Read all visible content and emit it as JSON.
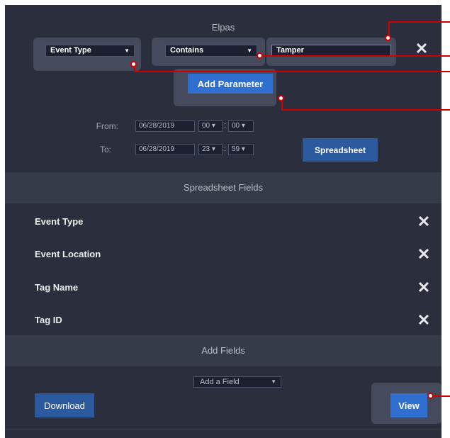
{
  "header": {
    "title": "Elpas"
  },
  "filter": {
    "field_select": "Event Type",
    "operator_select": "Contains",
    "value_input": "Tamper",
    "add_parameter_label": "Add Parameter"
  },
  "range": {
    "from_label": "From:",
    "to_label": "To:",
    "from_date": "06/28/2019",
    "from_hour": "00",
    "from_minute": "00",
    "to_date": "06/28/2019",
    "to_hour": "23",
    "to_minute": "59",
    "spreadsheet_label": "Spreadsheet"
  },
  "spreadsheet_fields": {
    "title": "Spreadsheet Fields",
    "items": [
      {
        "label": "Event Type"
      },
      {
        "label": "Event Location"
      },
      {
        "label": "Tag Name"
      },
      {
        "label": "Tag ID"
      }
    ]
  },
  "add_fields": {
    "title": "Add Fields",
    "select_value": "Add a Field",
    "download_label": "Download",
    "view_label": "View"
  },
  "icons": {
    "remove": "close-icon",
    "dropdown": "caret-down-icon"
  },
  "colors": {
    "panel_bg": "#2b2f3d",
    "section_bg": "#363b4a",
    "highlight": "#454b5c",
    "primary_button": "#2f6fcf",
    "callout": "#d00000"
  }
}
